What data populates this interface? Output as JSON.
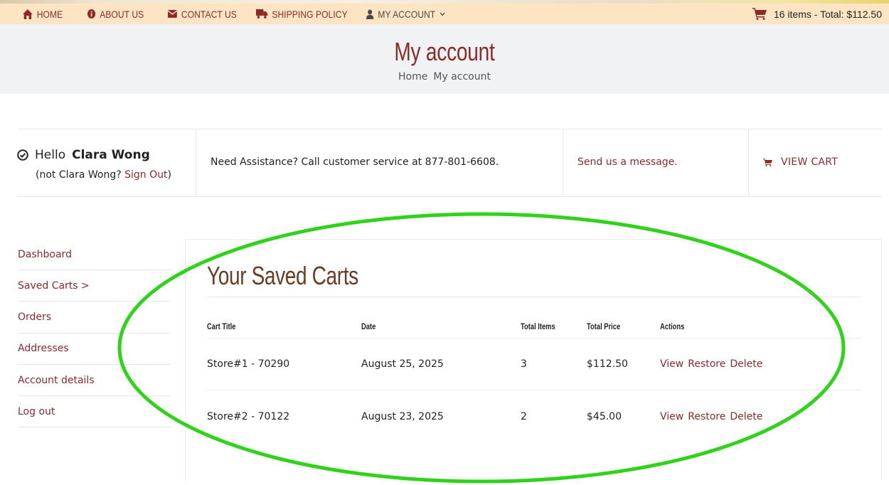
{
  "nav": {
    "items": [
      {
        "label": "HOME",
        "icon": "home-icon"
      },
      {
        "label": "ABOUT US",
        "icon": "info-circle-icon"
      },
      {
        "label": "CONTACT US",
        "icon": "envelope-icon"
      },
      {
        "label": "SHIPPING POLICY",
        "icon": "truck-icon"
      },
      {
        "label": "MY ACCOUNT",
        "icon": "user-icon"
      }
    ],
    "cart_summary": "16 items - Total: $112.50"
  },
  "header": {
    "title": "My account",
    "breadcrumb": [
      "Home",
      "My account"
    ]
  },
  "info": {
    "hello": "Hello",
    "user_name": "Clara Wong",
    "not_prefix": "(not Clara Wong? ",
    "sign_out": "Sign Out",
    "not_suffix": ")",
    "assistance": "Need Assistance? Call customer service at 877-801-6608.",
    "send_message": "Send us a message.",
    "view_cart": "VIEW CART"
  },
  "sidebar": {
    "items": [
      {
        "label": "Dashboard"
      },
      {
        "label": "Saved Carts >"
      },
      {
        "label": "Orders"
      },
      {
        "label": "Addresses"
      },
      {
        "label": "Account details"
      },
      {
        "label": "Log out"
      }
    ]
  },
  "saved_carts": {
    "title": "Your Saved Carts",
    "columns": [
      "Cart Title",
      "Date",
      "Total Items",
      "Total Price",
      "Actions"
    ],
    "rows": [
      {
        "title": "Store#1 - 70290",
        "date": "August 25, 2025",
        "items": "3",
        "price": "$112.50",
        "actions": {
          "view": "View",
          "restore": "Restore",
          "delete": "Delete"
        }
      },
      {
        "title": "Store#2 - 70122",
        "date": "August 23, 2025",
        "items": "2",
        "price": "$45.00",
        "actions": {
          "view": "View",
          "restore": "Restore",
          "delete": "Delete"
        }
      }
    ]
  },
  "colors": {
    "accent": "#8c2a2a",
    "nav_bg": "#fde5c4",
    "title_band_bg": "#f1f2f3",
    "heading_brown": "#6b3b22",
    "annotation_green": "#2fd41a"
  }
}
